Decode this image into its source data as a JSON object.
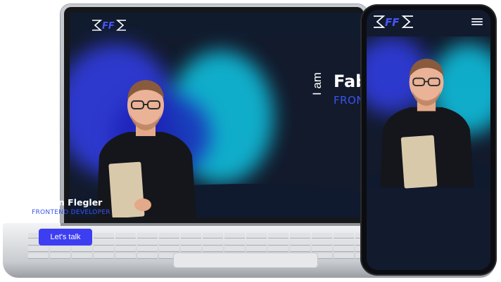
{
  "laptop": {
    "logo_text": "FF",
    "hero": {
      "intro": "I am",
      "name": "Fab",
      "role": "FRON"
    }
  },
  "phone": {
    "logo_text": "FF",
    "menu_icon": "hamburger-menu-icon",
    "hero": {
      "intro": "I am",
      "name": "Fabian Flegler",
      "role": "FRONTEND DEVELOPER",
      "cta_label": "Let's talk"
    }
  },
  "colors": {
    "background": "#121a2e",
    "accent": "#3d3df2",
    "role_text": "#3c53f0",
    "blob_blue": "#2f3bd6",
    "blob_cyan": "#10c7e6"
  }
}
